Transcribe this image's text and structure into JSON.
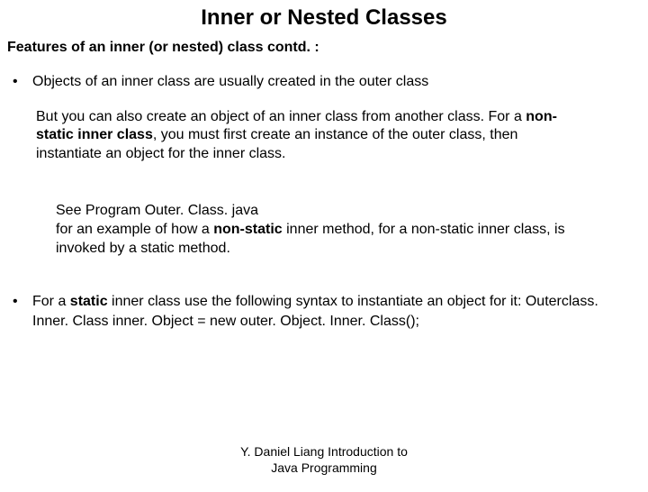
{
  "title": "Inner or Nested Classes",
  "subtitle": "Features of an inner (or nested) class contd. :",
  "bullet1": "Objects of an inner class are usually created in the outer class",
  "para1_a": "But you can also create an object of an inner class from another class. For a ",
  "para1_b": "non-static inner class",
  "para1_c": ", you must first create an instance of the outer class, then instantiate  an object for the inner class.",
  "para2_a": "See Program Outer. Class. java",
  "para2_b": " for an example of how a ",
  "para2_c": "non-static",
  "para2_d": " inner method, for a non-static inner class, is invoked by a static method.",
  "bullet2_a": "For a ",
  "bullet2_b": "static",
  "bullet2_c": " inner class use the following syntax to instantiate an object for it: Outerclass. Inner. Class inner. Object =  new outer. Object. Inner. Class();",
  "footer1": "Y. Daniel Liang Introduction to",
  "footer2": "Java Programming"
}
